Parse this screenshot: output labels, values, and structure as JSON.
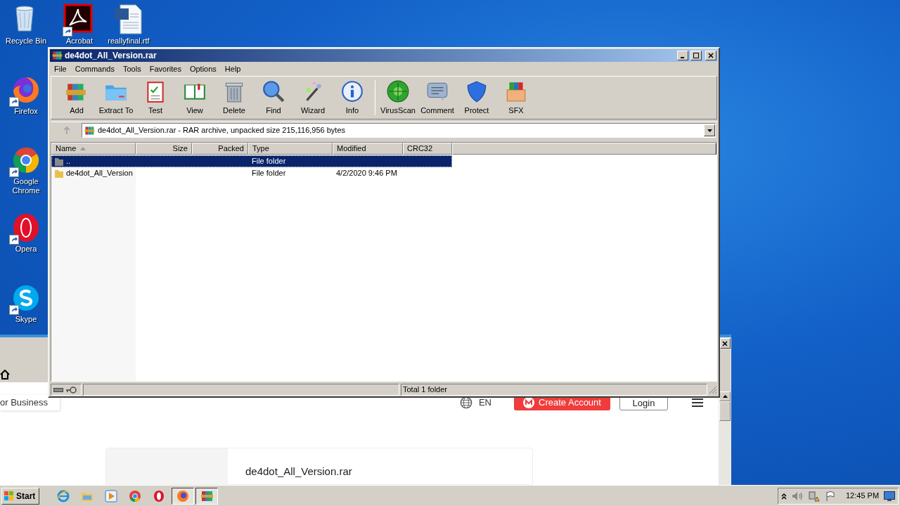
{
  "desktop_icons": [
    {
      "label": "Recycle Bin"
    },
    {
      "label": "Acrobat"
    },
    {
      "label": "reallyfinal.rtf"
    },
    {
      "label": "Firefox"
    },
    {
      "label": "Google Chrome"
    },
    {
      "label": "Opera"
    },
    {
      "label": "Skype"
    }
  ],
  "browser": {
    "tab_label": "or Business",
    "language": "EN",
    "create_account": "Create Account",
    "login": "Login",
    "card_title": "de4dot_All_Version.rar"
  },
  "winrar": {
    "title": "de4dot_All_Version.rar",
    "menu": [
      "File",
      "Commands",
      "Tools",
      "Favorites",
      "Options",
      "Help"
    ],
    "toolbar": [
      {
        "label": "Add"
      },
      {
        "label": "Extract To"
      },
      {
        "label": "Test"
      },
      {
        "label": "View"
      },
      {
        "label": "Delete"
      },
      {
        "label": "Find"
      },
      {
        "label": "Wizard"
      },
      {
        "label": "Info"
      },
      {
        "label": "VirusScan"
      },
      {
        "label": "Comment"
      },
      {
        "label": "Protect"
      },
      {
        "label": "SFX"
      }
    ],
    "address": "de4dot_All_Version.rar - RAR archive, unpacked size 215,116,956 bytes",
    "columns": [
      {
        "label": "Name",
        "sorted": true
      },
      {
        "label": "Size",
        "sorted": false
      },
      {
        "label": "Packed",
        "sorted": false
      },
      {
        "label": "Type",
        "sorted": false
      },
      {
        "label": "Modified",
        "sorted": false
      },
      {
        "label": "CRC32",
        "sorted": false
      }
    ],
    "rows": [
      {
        "name": "..",
        "type": "File folder",
        "selected": true
      },
      {
        "name": "de4dot_All_Version",
        "type": "File folder",
        "modified": "4/2/2020 9:46 PM",
        "selected": false
      }
    ],
    "status": "Total 1 folder"
  },
  "taskbar": {
    "start": "Start",
    "apps": [
      {
        "selected": false
      },
      {
        "selected": false
      },
      {
        "selected": false
      },
      {
        "selected": false
      },
      {
        "selected": false
      },
      {
        "selected": true
      },
      {
        "selected": true
      }
    ],
    "clock": "12:45 PM"
  }
}
